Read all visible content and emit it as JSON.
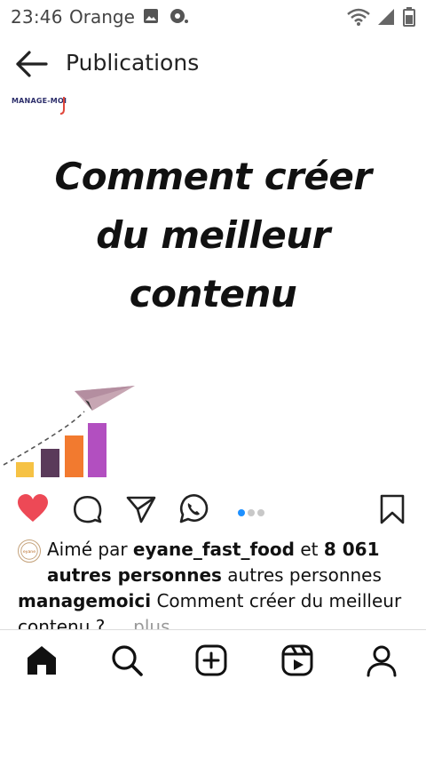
{
  "status_bar": {
    "time": "23:46",
    "carrier": "Orange",
    "icons": [
      "image-icon",
      "vpn-icon",
      "wifi-icon",
      "signal-icon",
      "battery-icon"
    ]
  },
  "header": {
    "title": "Publications",
    "back_icon": "arrow-left-icon"
  },
  "post": {
    "brand": "MANAGE-MOI",
    "headline_lines": [
      "Comment créer",
      "du meilleur",
      "contenu"
    ],
    "art": {
      "description_icons": [
        "paper-plane-icon",
        "growth-bars-icon"
      ],
      "bar_colors": [
        "#f6c244",
        "#5a3a5a",
        "#f27a2f",
        "#b24fc0"
      ]
    },
    "carousel": {
      "count": 3,
      "active_index": 0
    }
  },
  "actions": {
    "like_icon": "heart-icon",
    "comment_icon": "comment-icon",
    "share_icon": "send-icon",
    "whatsapp_icon": "whatsapp-icon",
    "save_icon": "bookmark-icon",
    "liked": true,
    "like_color": "#ed4956"
  },
  "likes": {
    "prefix": "Aimé par",
    "user": "eyane_fast_food",
    "connector": "et",
    "count_text": "8 061 autres personnes",
    "suffix": "autres personnes"
  },
  "caption": {
    "username": "managemoici",
    "text": "Comment créer du meilleur contenu ?",
    "more": "... plus"
  },
  "bottom_nav": {
    "items": [
      {
        "icon": "home-icon",
        "active": true
      },
      {
        "icon": "search-icon",
        "active": false
      },
      {
        "icon": "add-post-icon",
        "active": false
      },
      {
        "icon": "reels-icon",
        "active": false
      },
      {
        "icon": "profile-icon",
        "active": false
      }
    ]
  }
}
